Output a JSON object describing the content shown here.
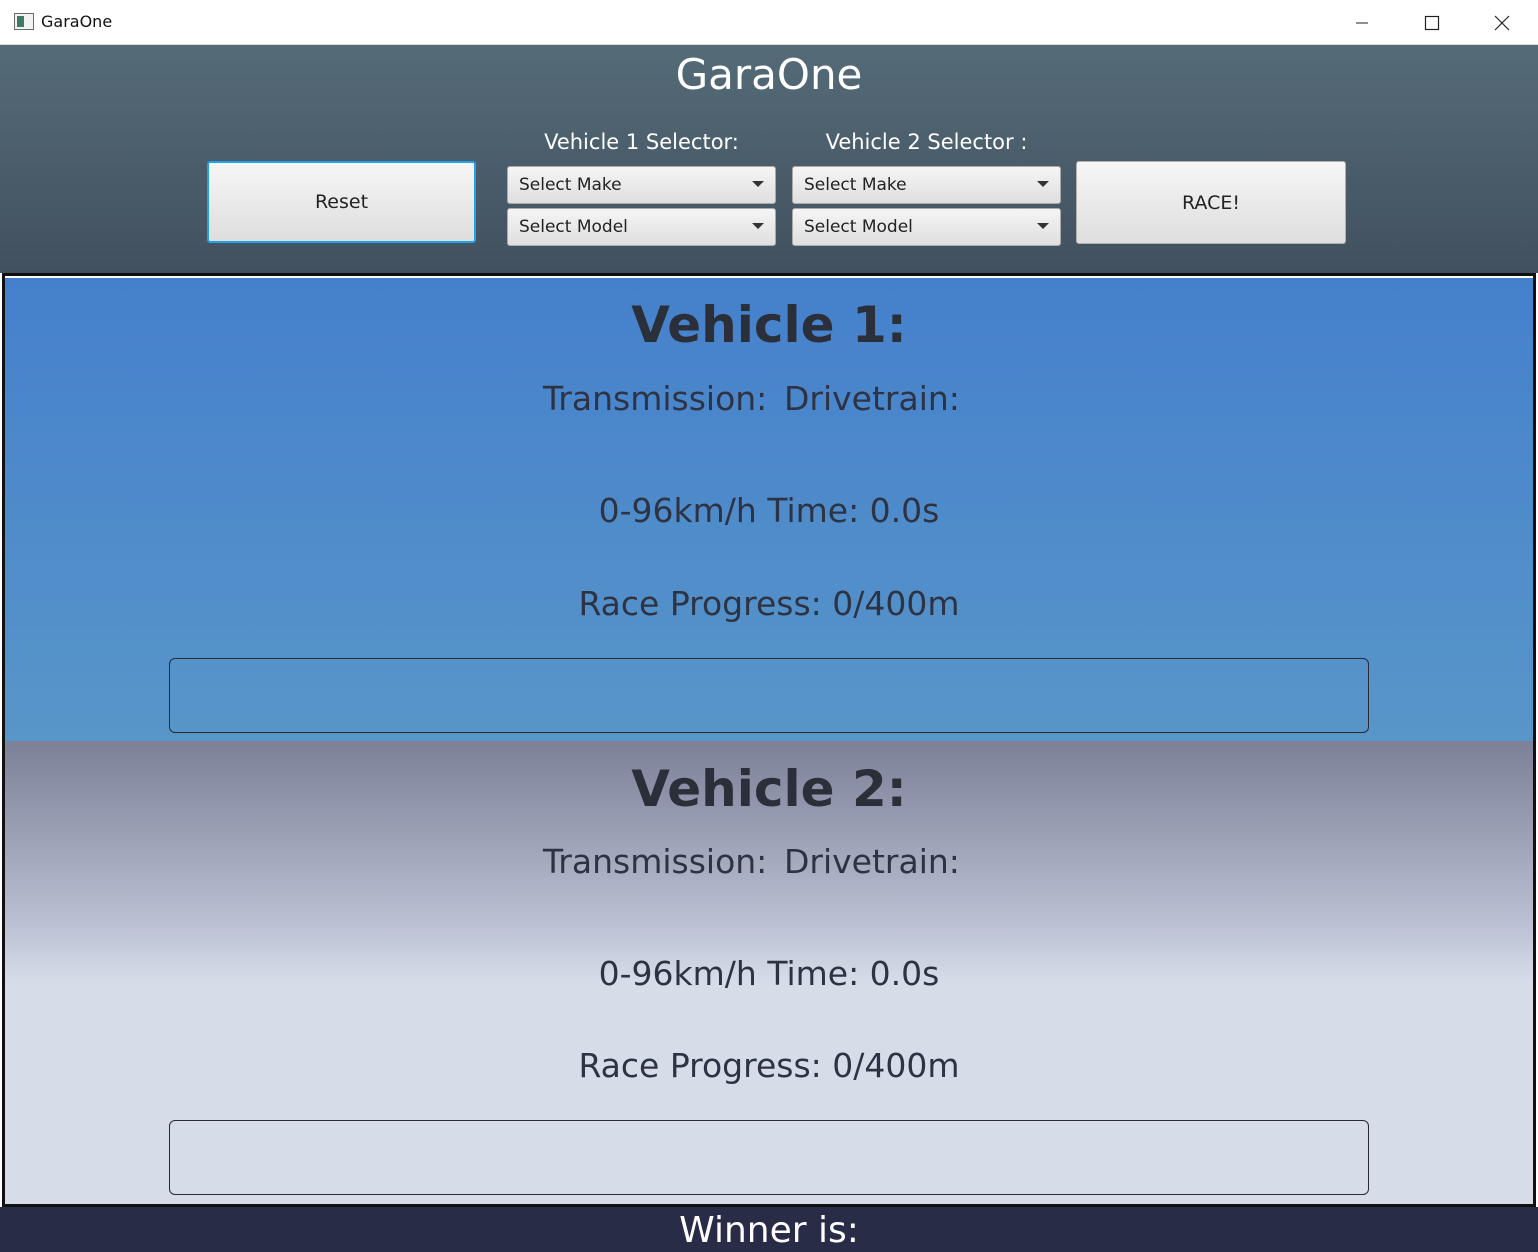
{
  "window": {
    "title": "GaraOne",
    "minimize_glyph": "—",
    "maximize_glyph": "☐",
    "close_glyph": "✕"
  },
  "header": {
    "app_title": "GaraOne",
    "reset_label": "Reset",
    "race_label": "RACE!",
    "vehicle1_selector_label": "Vehicle 1 Selector:",
    "vehicle2_selector_label": "Vehicle 2 Selector :",
    "vehicle1_make": "Select Make",
    "vehicle1_model": "Select Model",
    "vehicle2_make": "Select Make",
    "vehicle2_model": "Select Model"
  },
  "vehicle1": {
    "title": "Vehicle 1:",
    "transmission_label": "Transmission:",
    "drivetrain_label": "Drivetrain:",
    "time_text": "0-96km/h Time: 0.0s",
    "progress_text": "Race Progress: 0/400m",
    "progress_fraction": 0
  },
  "vehicle2": {
    "title": "Vehicle 2:",
    "transmission_label": "Transmission:",
    "drivetrain_label": "Drivetrain:",
    "time_text": "0-96km/h Time: 0.0s",
    "progress_text": "Race Progress: 0/400m",
    "progress_fraction": 0
  },
  "footer": {
    "winner_label": "Winner is:"
  },
  "colors": {
    "header_top": "#556b78",
    "header_bottom": "#41505f",
    "vehicle1_panel": "#4580cc",
    "vehicle2_panel": "#d6dce8",
    "winner_bar": "#282c47",
    "reset_focus_border": "#1fa3e4"
  }
}
